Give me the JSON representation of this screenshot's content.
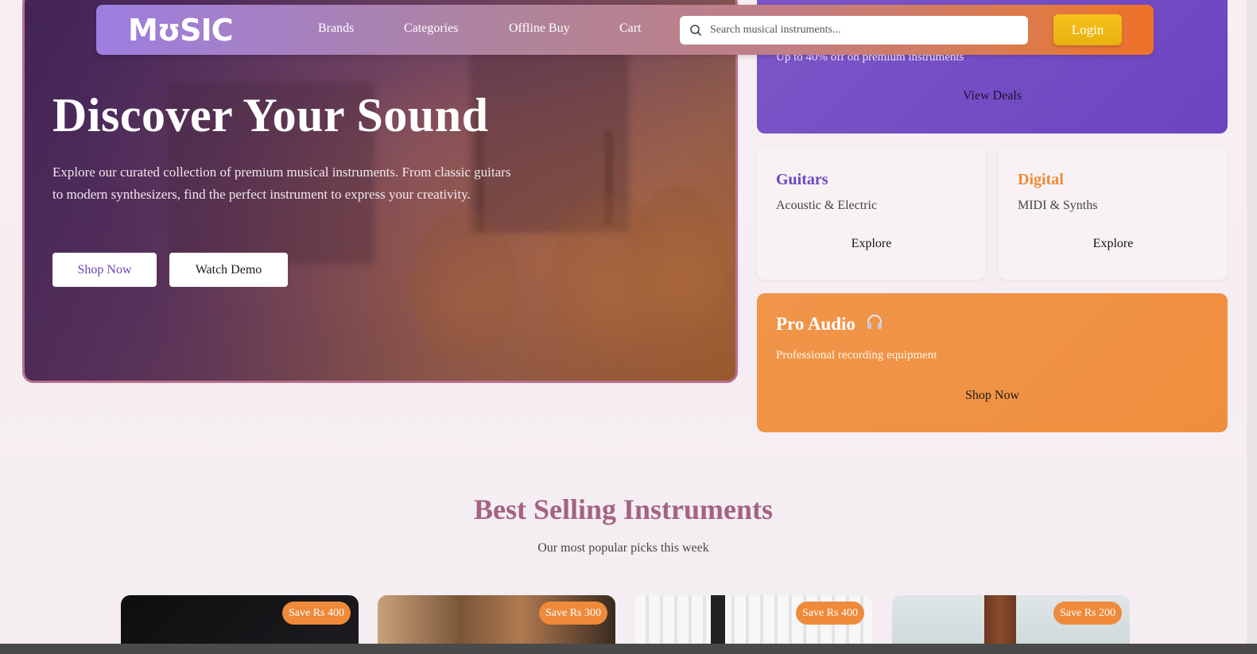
{
  "brand": {
    "logo": "MʊSIC"
  },
  "nav": {
    "links": [
      "Brands",
      "Categories",
      "Offline Buy",
      "Cart"
    ],
    "search_placeholder": "Search musical instruments...",
    "login": "Login"
  },
  "hero": {
    "title": "Discover Your Sound",
    "description": "Explore our curated collection of premium musical instruments. From classic guitars to modern synthesizers, find the perfect instrument to express your creativity.",
    "primary_button": "Shop Now",
    "secondary_button": "Watch Demo"
  },
  "deal": {
    "subtitle": "Up to 40% off on premium instruments",
    "link": "View Deals"
  },
  "categories": [
    {
      "title": "Guitars",
      "subtitle": "Acoustic & Electric",
      "link": "Explore",
      "color": "#6b45c0"
    },
    {
      "title": "Digital",
      "subtitle": "MIDI & Synths",
      "link": "Explore",
      "color": "#ee8a3a"
    }
  ],
  "pro_audio": {
    "title": "Pro Audio",
    "icon": "headphones-icon",
    "subtitle": "Professional recording equipment",
    "link": "Shop Now"
  },
  "best_selling": {
    "title": "Best Selling Instruments",
    "subtitle": "Our most popular picks this week",
    "products": [
      {
        "badge": "Save Rs 400"
      },
      {
        "badge": "Save Rs 300"
      },
      {
        "badge": "Save Rs 400"
      },
      {
        "badge": "Save Rs 200"
      }
    ]
  },
  "colors": {
    "accent_purple": "#6b45c0",
    "accent_orange": "#ee8a3a",
    "login_yellow": "#f7c11c",
    "section_title": "#a5637f"
  }
}
